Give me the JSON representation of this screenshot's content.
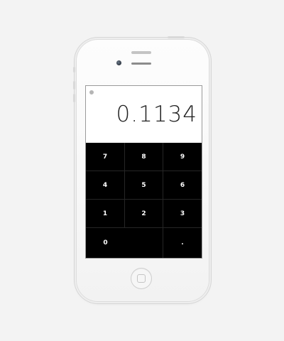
{
  "calculator": {
    "display_value": "0.1134",
    "keys": {
      "seven": "7",
      "eight": "8",
      "nine": "9",
      "four": "4",
      "five": "5",
      "six": "6",
      "one": "1",
      "two": "2",
      "three": "3",
      "zero": "0",
      "decimal": "."
    }
  },
  "icons": {
    "info": "info-icon",
    "home": "home-button-icon",
    "camera": "front-camera-icon",
    "speaker": "earpiece-speaker-icon"
  },
  "colors": {
    "keypad_background": "#000000",
    "key_text": "#ffffff",
    "display_background": "#ffffff",
    "display_text": "#222222",
    "page_background": "#f3f3f3"
  }
}
